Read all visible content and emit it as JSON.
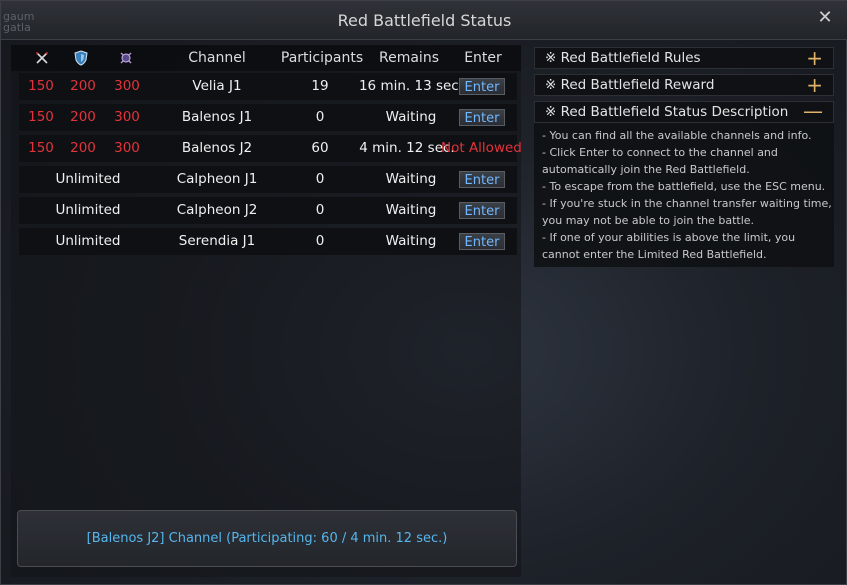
{
  "window": {
    "title": "Red Battlefield Status",
    "background_text": "gaum\ngatla"
  },
  "table": {
    "header": {
      "icons": [
        "crossed-swords-icon",
        "shield-icon",
        "crest-icon"
      ],
      "channel": "Channel",
      "participants": "Participants",
      "remains": "Remains",
      "enter": "Enter"
    },
    "rows": [
      {
        "ap": "150",
        "dp": "200",
        "total": "300",
        "channel": "Velia J1",
        "participants": "19",
        "remains": "16 min. 13 sec.",
        "enter": "Enter"
      },
      {
        "ap": "150",
        "dp": "200",
        "total": "300",
        "channel": "Balenos J1",
        "participants": "0",
        "remains": "Waiting",
        "enter": "Enter"
      },
      {
        "ap": "150",
        "dp": "200",
        "total": "300",
        "channel": "Balenos J2",
        "participants": "60",
        "remains": "4 min. 12 sec.",
        "enter": "Not Allowed"
      },
      {
        "limit": "Unlimited",
        "channel": "Calpheon J1",
        "participants": "0",
        "remains": "Waiting",
        "enter": "Enter"
      },
      {
        "limit": "Unlimited",
        "channel": "Calpheon J2",
        "participants": "0",
        "remains": "Waiting",
        "enter": "Enter"
      },
      {
        "limit": "Unlimited",
        "channel": "Serendia J1",
        "participants": "0",
        "remains": "Waiting",
        "enter": "Enter"
      }
    ]
  },
  "status": {
    "text": "[Balenos J2] Channel (Participating: 60 / 4 min. 12 sec.)"
  },
  "sections": [
    {
      "label": "※ Red Battlefield Rules",
      "toggle": "+"
    },
    {
      "label": "※ Red Battlefield Reward",
      "toggle": "+"
    },
    {
      "label": "※ Red Battlefield Status Description",
      "toggle": "—"
    }
  ],
  "description": [
    "- You can find all the available channels and info.",
    "- Click Enter to connect to the channel and",
    "automatically join the Red Battlefield.",
    "- To escape from the battlefield, use the ESC menu.",
    "- If you're stuck in the channel transfer waiting time,",
    "you may not be able to join the battle.",
    "- If one of your abilities is above the limit, you",
    "cannot enter the Limited Red Battlefield."
  ],
  "colors": {
    "limit_red": "#e2333b",
    "enter_blue": "#6fb7ff",
    "status_cyan": "#55b6ee",
    "toggle_gold": "#e0b36a"
  }
}
